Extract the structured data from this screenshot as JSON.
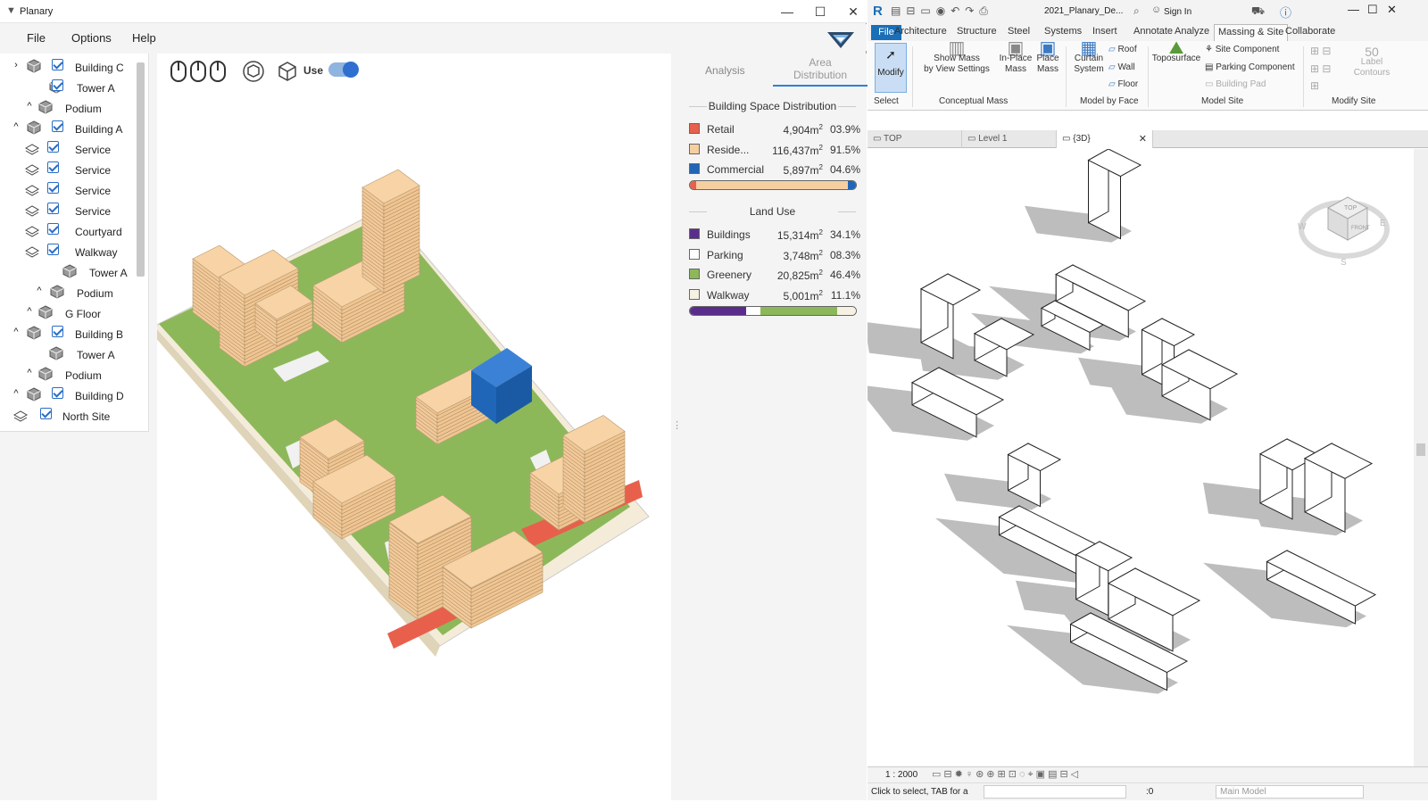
{
  "planary": {
    "app_title": "Planary",
    "window_controls": {
      "minimize": "—",
      "maximize": "☐",
      "close": "✕"
    },
    "menu": {
      "file": "File",
      "options": "Options",
      "help": "Help"
    },
    "tree": [
      {
        "label": "Building C",
        "expand": "›"
      },
      {
        "label": "Tower A",
        "expand": ""
      },
      {
        "label": "Podium",
        "expand": "^"
      },
      {
        "label": "Building A",
        "expand": "^"
      },
      {
        "label": "Service",
        "expand": ""
      },
      {
        "label": "Service",
        "expand": ""
      },
      {
        "label": "Service",
        "expand": ""
      },
      {
        "label": "Service",
        "expand": ""
      },
      {
        "label": "Courtyard",
        "expand": ""
      },
      {
        "label": "Walkway",
        "expand": ""
      },
      {
        "label": "Tower A",
        "expand": ""
      },
      {
        "label": "Podium",
        "expand": "^"
      },
      {
        "label": "G Floor",
        "expand": "^"
      },
      {
        "label": "Building B",
        "expand": "^"
      },
      {
        "label": "Tower A",
        "expand": ""
      },
      {
        "label": "Podium",
        "expand": "^"
      },
      {
        "label": "Building D",
        "expand": "^"
      },
      {
        "label": "North Site",
        "expand": ""
      }
    ],
    "toolbar": {
      "use_label": "Use",
      "use_toggle_on": true
    },
    "panel": {
      "tab_analysis": "Analysis",
      "tab_area_line1": "Area",
      "tab_area_line2": "Distribution",
      "bsd_title": "Building Space Distribution",
      "bsd": [
        {
          "name": "Retail",
          "area": "4,904m",
          "pct": "03.9%",
          "color": "#e8604c"
        },
        {
          "name": "Reside...",
          "area": "116,437m",
          "pct": "91.5%",
          "color": "#f6cfa0"
        },
        {
          "name": "Commercial",
          "area": "5,897m",
          "pct": "04.6%",
          "color": "#1f66b8"
        }
      ],
      "bsd_fractions": [
        0.039,
        0.915,
        0.046
      ],
      "lu_title": "Land Use",
      "lu": [
        {
          "name": "Buildings",
          "area": "15,314m",
          "pct": "34.1%",
          "color": "#5a2d8c"
        },
        {
          "name": "Parking",
          "area": "3,748m",
          "pct": "08.3%",
          "color": "#ffffff"
        },
        {
          "name": "Greenery",
          "area": "20,825m",
          "pct": "46.4%",
          "color": "#8db85a"
        },
        {
          "name": "Walkway",
          "area": "5,001m",
          "pct": "11.1%",
          "color": "#f6f1e2"
        }
      ],
      "lu_fractions": [
        0.341,
        0.083,
        0.464,
        0.111
      ],
      "sup": "2"
    }
  },
  "revit": {
    "doc_title": "2021_Planary_De...",
    "sign_in": "Sign In",
    "tabs": [
      "File",
      "Architecture",
      "Structure",
      "Steel",
      "Systems",
      "Insert",
      "Annotate",
      "Analyze",
      "Massing & Site",
      "Collaborate"
    ],
    "ribbon": {
      "modify": "Modify",
      "select": "Select",
      "show_mass_1": "Show Mass",
      "show_mass_2": "by View Settings",
      "inplace_1": "In-Place",
      "inplace_2": "Mass",
      "place_1": "Place",
      "place_2": "Mass",
      "curtain_1": "Curtain",
      "curtain_2": "System",
      "roof": "Roof",
      "wall": "Wall",
      "floor": "Floor",
      "toposurface": "Toposurface",
      "site_component": "Site Component",
      "parking_component": "Parking Component",
      "building_pad": "Building Pad",
      "label_contours_1": "Label",
      "label_contours_2": "Contours",
      "grp_conceptual": "Conceptual Mass",
      "grp_face": "Model by Face",
      "grp_site": "Model Site",
      "grp_modify_site": "Modify Site"
    },
    "view_tabs": [
      "TOP",
      "Level 1",
      "{3D}"
    ],
    "viewcube": {
      "top": "TOP",
      "front": "FRONT",
      "west": "W",
      "south": "S",
      "east": "E"
    },
    "scale": "1 : 2000",
    "status_hint": "Click to select, TAB for a",
    "counter": ":0",
    "model": "Main Model"
  }
}
